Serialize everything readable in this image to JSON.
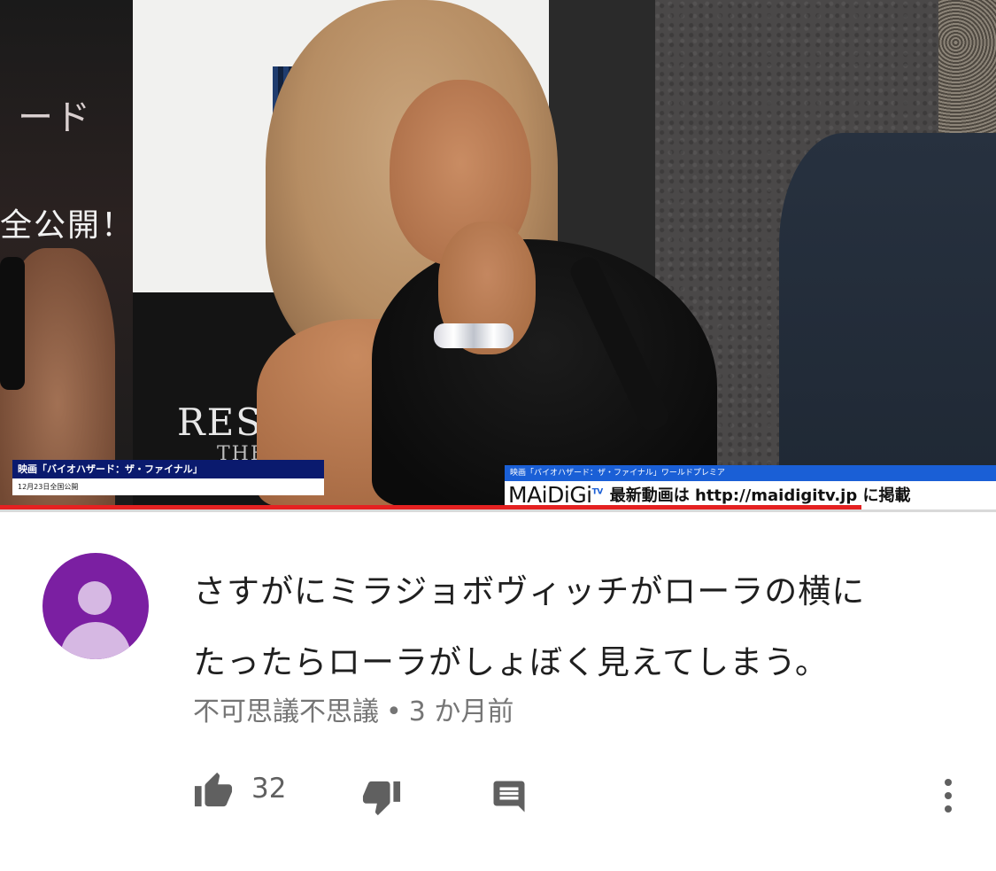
{
  "video": {
    "overlay_left": {
      "title": "映画「バイオハザード：ザ・ファイナル」",
      "subtitle": "12月23日全国公開"
    },
    "overlay_right": {
      "title": "映画「バイオハザード：ザ・ファイナル」ワールドプレミア",
      "brand": "MAiDiGi",
      "brand_tv": "TV",
      "message": "最新動画は http://maidigitv.jp に掲載"
    },
    "background_text": {
      "panel_left_1": "ード",
      "panel_left_2": "全公開！",
      "panel_bottom": "RES",
      "panel_bottom_2": "THE"
    },
    "progress_fraction": 0.865
  },
  "comment": {
    "text_line1": "さすがにミラジョボヴィッチがローラの横に",
    "text_line2": "たったらローラがしょぼく見えてしまう。",
    "author": "不可思議不思議",
    "separator": "•",
    "time": "3 か月前",
    "like_count": "32"
  },
  "colors": {
    "avatar_bg": "#7b1fa2",
    "avatar_fg": "#d6b8e3",
    "progress": "#e52121",
    "icon": "#606060",
    "meta": "#757575"
  },
  "icons": {
    "like": "thumb-up-icon",
    "dislike": "thumb-down-icon",
    "reply": "comment-reply-icon",
    "more": "more-vertical-icon"
  }
}
